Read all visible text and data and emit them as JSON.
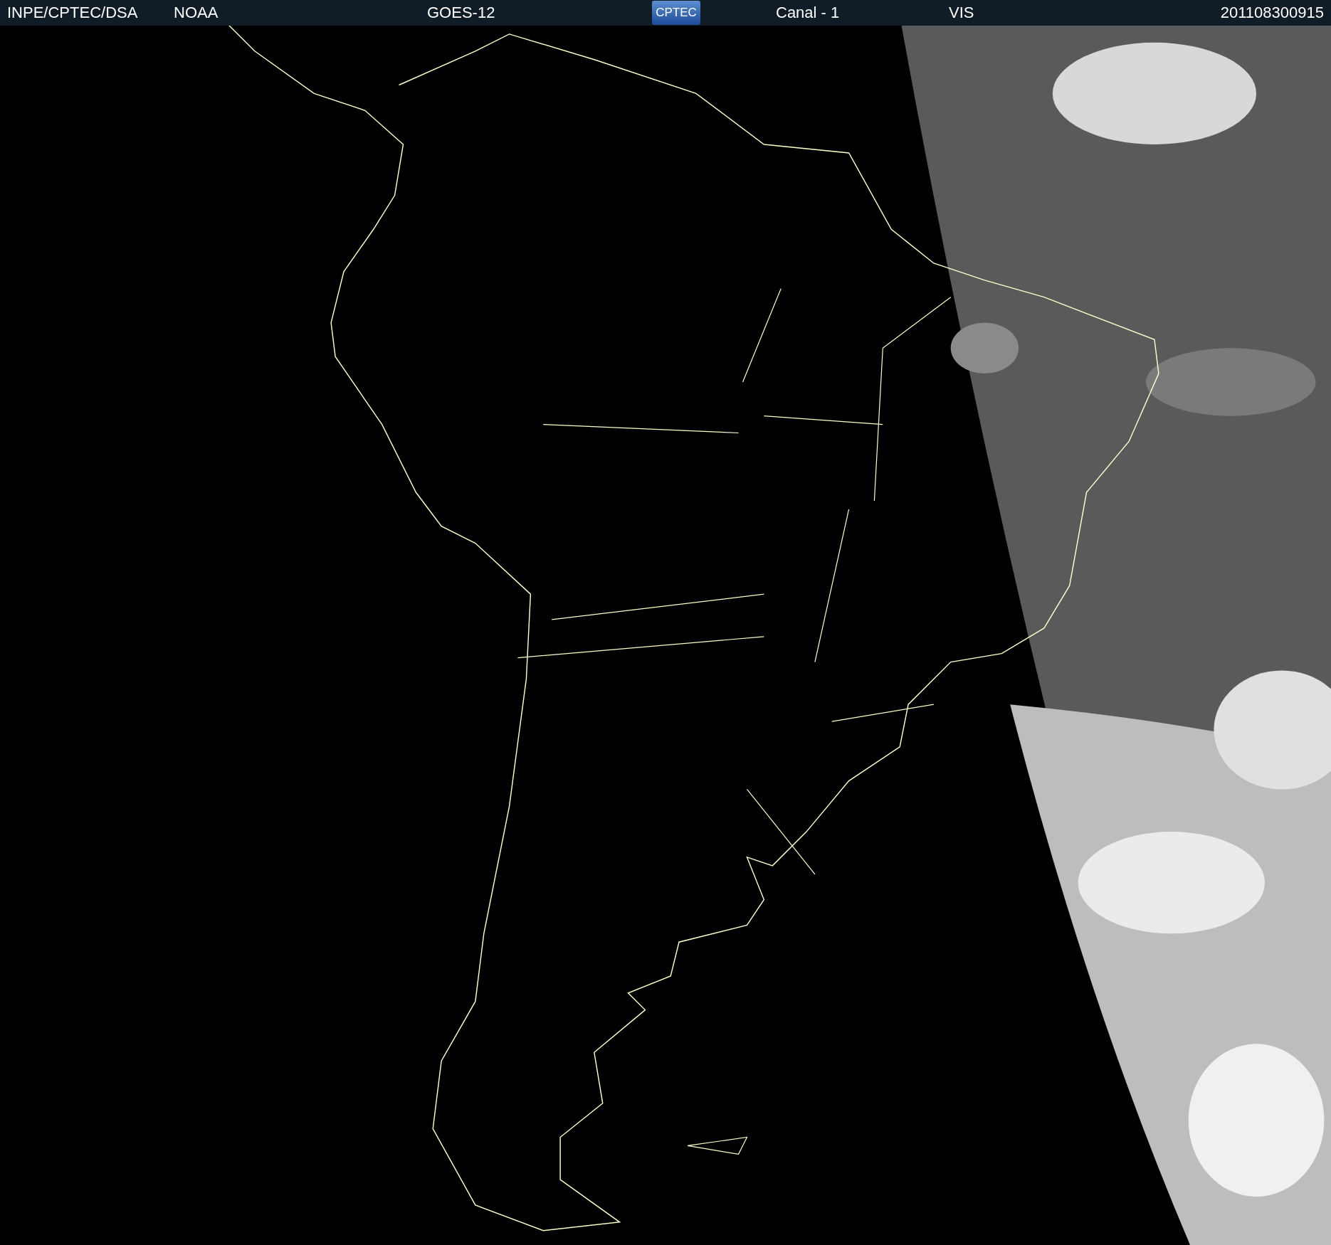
{
  "header": {
    "source": "INPE/CPTEC/DSA",
    "agency": "NOAA",
    "satellite": "GOES-12",
    "logo": "CPTEC",
    "channel": "Canal - 1",
    "band": "VIS",
    "timestamp": "201108300915"
  }
}
